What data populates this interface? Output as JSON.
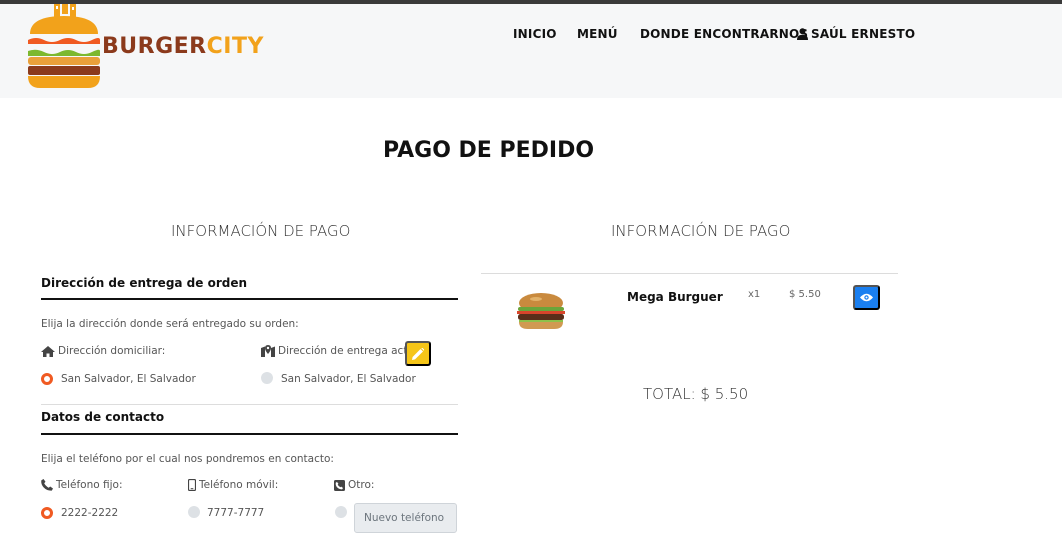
{
  "brand": {
    "word1": "BURGER",
    "word2": "CITY",
    "color1": "#8b3a1c",
    "color2": "#f2a21b"
  },
  "nav": {
    "items": [
      {
        "label": "INICIO"
      },
      {
        "label": "MENÚ"
      },
      {
        "label": "DONDE ENCONTRARNOS"
      }
    ],
    "user": {
      "label": "SAÚL ERNESTO",
      "icon": "user-icon"
    }
  },
  "page": {
    "title": "PAGO DE PEDIDO"
  },
  "payment_info": {
    "title": "INFORMACIÓN DE PAGO",
    "delivery": {
      "heading": "Dirección de entrega de orden",
      "instruction": "Elija la dirección donde será entregado su orden:",
      "home_label": "Dirección domiciliar:",
      "current_label": "Dirección de entrega actual:",
      "home_value": "San Salvador, El Salvador",
      "current_value": "San Salvador, El Salvador",
      "selected": "home"
    },
    "contact": {
      "heading": "Datos de contacto",
      "instruction": "Elija el teléfono por el cual nos pondremos en contacto:",
      "fixed_label": "Teléfono fijo:",
      "mobile_label": "Teléfono móvil:",
      "other_label": "Otro:",
      "fixed_value": "2222-2222",
      "mobile_value": "7777-7777",
      "other_placeholder": "Nuevo teléfono",
      "selected": "fixed"
    }
  },
  "order_info": {
    "title": "INFORMACIÓN DE PAGO",
    "items": [
      {
        "name": "Mega Burguer",
        "qty": "x1",
        "price": "$ 5.50"
      }
    ],
    "total": "TOTAL: $ 5.50"
  },
  "colors": {
    "accent_orange": "#f05a22",
    "edit_yellow": "#f5c518",
    "view_blue": "#1a7ff0"
  }
}
